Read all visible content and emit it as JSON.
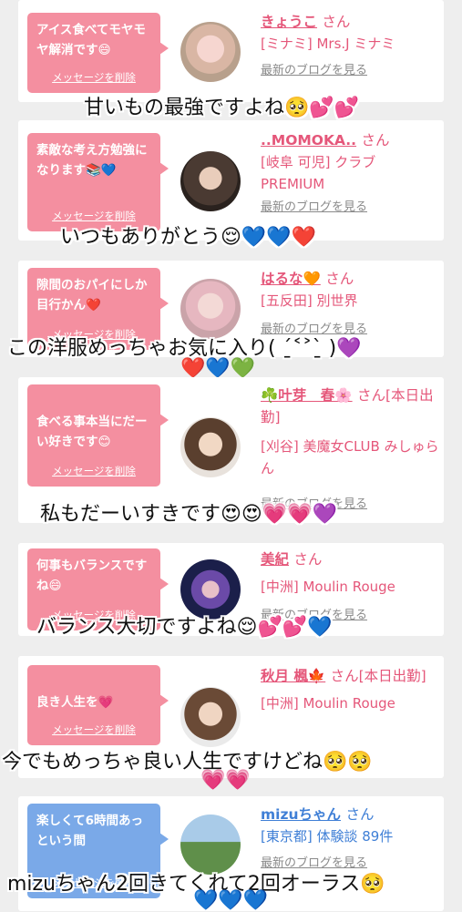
{
  "cards": [
    {
      "message": "アイス食べてモヤモヤ解消です😄",
      "delete_label": "メッセージを削除",
      "name": "きょうこ",
      "san": "さん",
      "shop": "[ミナミ] Mrs.J ミナミ",
      "blog_label": "最新のブログを見る",
      "comment": "甘いもの最強ですよね🥺💕💕"
    },
    {
      "message": "素敵な考え方勉強になります📚💙",
      "delete_label": "メッセージを削除",
      "name": "..MOMOKA..",
      "san": "さん",
      "shop": "[岐阜 可児] クラブ PREMIUM",
      "blog_label": "最新のブログを見る",
      "comment": "いつもありがとう😌💙💙❤️"
    },
    {
      "message": "隙間のおパイにしか目行かん❤️",
      "delete_label": "メッセージを削除",
      "name": "はるな🧡",
      "san": "さん",
      "shop": "[五反田] 別世界",
      "blog_label": "最新のブログを見る",
      "comment": "この洋服めっちゃお気に入り( ˊ̱˂˃ˋ̱ )💜",
      "comment2": "❤️💙💚"
    },
    {
      "message": "食べる事本当にだーい好きです😊",
      "delete_label": "メッセージを削除",
      "name": "☘️叶芽　春🌸",
      "san": "さん[本日出勤]",
      "shop": "[刈谷] 美魔女CLUB みしゅらん",
      "blog_label": "最新のブログを見る",
      "comment": "私もだーいすきです😍😍💗💗💜"
    },
    {
      "message": "何事もバランスですね😄",
      "delete_label": "メッセージを削除",
      "name": "美紀",
      "san": "さん",
      "shop": "[中洲] Moulin Rouge",
      "blog_label": "最新のブログを見る",
      "comment": "バランス大切ですよね😌💕💕💙"
    },
    {
      "message": "良き人生を💗",
      "delete_label": "メッセージを削除",
      "name": "秋月 楓🍁",
      "san": "さん[本日出勤]",
      "shop": "[中洲] Moulin Rouge",
      "blog_label": "最新のブログを見る",
      "comment": "今でもめっちゃ良い人生ですけどね🥺🥺",
      "comment2": "💗💗"
    },
    {
      "message": "楽しくて6時間あっという間",
      "delete_label": "メッセージを削除",
      "name": "mizuちゃん",
      "san": "さん",
      "shop": "[東京都] 体験談 89件",
      "blog_label": "最新のブログを見る",
      "comment": "mizuちゃん2回きてくれて2回オーラス🥺",
      "comment2": "💙💙💙"
    }
  ]
}
